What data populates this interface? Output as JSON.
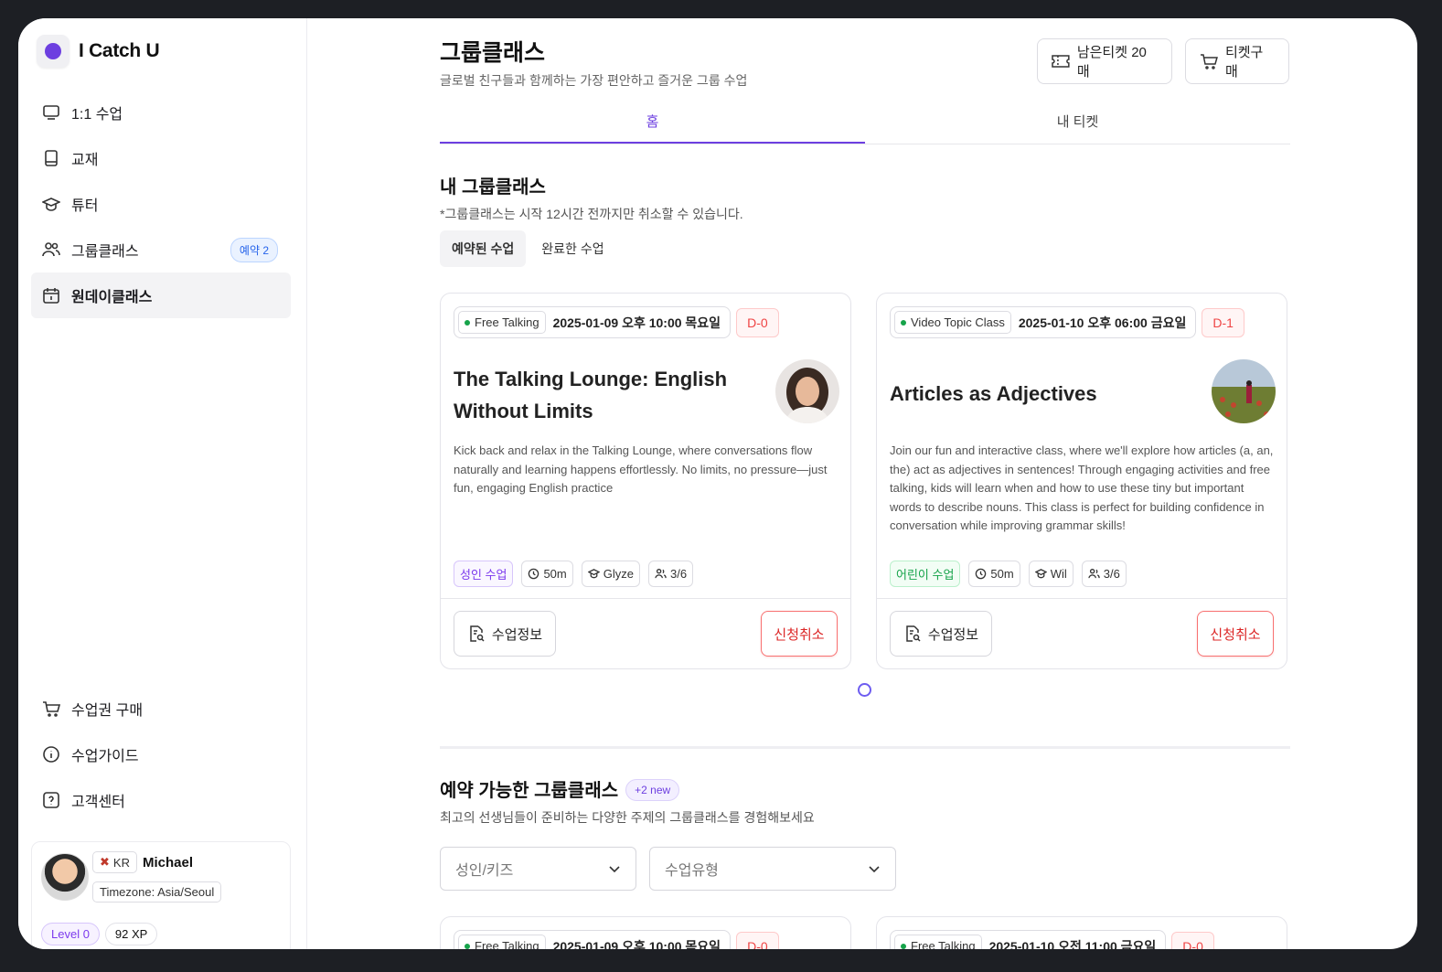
{
  "brand": {
    "name": "I Catch U"
  },
  "sidebar": {
    "items": [
      {
        "label": "1:1 수업",
        "icon": "monitor-icon"
      },
      {
        "label": "교재",
        "icon": "book-icon"
      },
      {
        "label": "튜터",
        "icon": "graduation-cap-icon"
      },
      {
        "label": "그룹클래스",
        "icon": "users-icon",
        "badge": "예약 2"
      },
      {
        "label": "원데이클래스",
        "icon": "calendar-icon",
        "active": true
      }
    ],
    "bottom_items": [
      {
        "label": "수업권 구매",
        "icon": "cart-icon"
      },
      {
        "label": "수업가이드",
        "icon": "info-icon"
      },
      {
        "label": "고객센터",
        "icon": "help-icon"
      }
    ],
    "profile": {
      "country": "KR",
      "name": "Michael",
      "timezone": "Timezone: Asia/Seoul",
      "level": "Level 0",
      "xp": "92 XP"
    }
  },
  "header": {
    "title": "그룹클래스",
    "subtitle": "글로벌 친구들과 함께하는 가장 편안하고 즐거운 그룹 수업",
    "tickets_btn": "남은티켓 20매",
    "buy_btn": "티켓구매"
  },
  "tabs": [
    {
      "label": "홈",
      "active": true
    },
    {
      "label": "내 티켓",
      "active": false
    }
  ],
  "my_classes": {
    "title": "내 그룹클래스",
    "note": "*그룹클래스는 시작 12시간 전까지만 취소할 수 있습니다.",
    "subtabs": [
      {
        "label": "예약된 수업",
        "active": true
      },
      {
        "label": "완료한 수업",
        "active": false
      }
    ],
    "cards": [
      {
        "type": "Free Talking",
        "datetime": "2025-01-09 오후 10:00 목요일",
        "dday": "D-0",
        "title": "The Talking Lounge: English Without Limits",
        "description": "Kick back and relax in the Talking Lounge, where conversations flow naturally and learning happens effortlessly. No limits, no pressure—just fun, engaging English practice",
        "audience": "성인 수업",
        "duration": "50m",
        "tutor": "Glyze",
        "capacity": "3/6",
        "info_btn": "수업정보",
        "cancel_btn": "신청취소"
      },
      {
        "type": "Video Topic Class",
        "datetime": "2025-01-10 오후 06:00 금요일",
        "dday": "D-1",
        "title": "Articles as Adjectives",
        "description": "Join our fun and interactive class, where we'll explore how articles (a, an, the) act as adjectives in sentences! Through engaging activities and free talking, kids will learn when and how to use these tiny but important words to describe nouns. This class is perfect for building confidence in conversation while improving grammar skills!",
        "audience": "어린이 수업",
        "duration": "50m",
        "tutor": "Wil",
        "capacity": "3/6",
        "info_btn": "수업정보",
        "cancel_btn": "신청취소"
      }
    ]
  },
  "available": {
    "title": "예약 가능한 그룹클래스",
    "new_badge": "+2 new",
    "subtitle": "최고의 선생님들이 준비하는 다양한 주제의 그룹클래스를 경험해보세요",
    "filter_audience": "성인/키즈",
    "filter_type": "수업유형",
    "peek_cards": [
      {
        "type": "Free Talking",
        "datetime": "2025-01-09 오후 10:00 목요일",
        "dday": "D-0"
      },
      {
        "type": "Free Talking",
        "datetime": "2025-01-10 오전 11:00 금요일",
        "dday": "D-0"
      }
    ]
  },
  "colors": {
    "accent": "#6d3fe0",
    "danger": "#dc2626",
    "kids": "#16a34a"
  }
}
